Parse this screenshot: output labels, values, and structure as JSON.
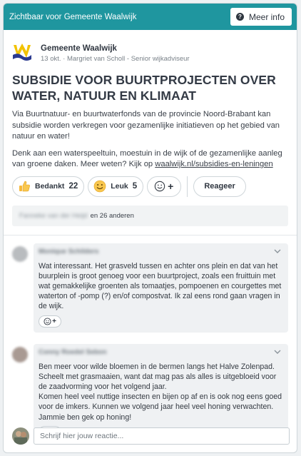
{
  "topbar": {
    "title": "Zichtbaar voor Gemeente Waalwijk",
    "info_label": "Meer info"
  },
  "post": {
    "author": "Gemeente Waalwijk",
    "meta": "13 okt. · Margriet van Scholl - Senior wijkadviseur",
    "title": "SUBSIDIE VOOR BUURTPROJECTEN OVER WATER, NATUUR EN KLIMAAT",
    "paragraph1": "Via Buurtnatuur- en buurtwaterfonds van de provincie Noord-Brabant kan subsidie worden verkregen voor gezamenlijke initiatieven op het gebied van natuur en water!",
    "paragraph2_prefix": "Denk aan een waterspeeltuin, moestuin in de wijk of de gezamenlijke aanleg van groene daken. Meer weten? Kijk op ",
    "link_text": "waalwijk.nl/subsidies-en-leningen"
  },
  "reactions": {
    "bedankt_label": "Bedankt",
    "bedankt_count": "22",
    "leuk_label": "Leuk",
    "leuk_count": "5",
    "add_label": "+",
    "reply_label": "Reageer"
  },
  "liked_by": {
    "blurred_name": "Fanneke van der Heijd",
    "others": "en 26 anderen"
  },
  "comments": [
    {
      "name": "Monique Schilders",
      "text": "Wat interessant. Het grasveld tussen en achter ons plein en dat van het buurplein is groot genoeg voor een buurtproject, zoals een fruittuin met wat gemakkelijke groenten als tomaatjes, pompoenen en courgettes met waterton of -pomp (?) en/of compostvat. Ik zal eens rond gaan vragen in de wijk.",
      "emoji_add": "+"
    },
    {
      "name": "Conny Roedel Sebon",
      "text_lines": [
        "Ben meer voor wilde bloemen in de bermen langs het Halve Zolenpad. Scheelt met grasmaaien, want dat mag pas als alles is uitgebloeid voor de zaadvorming voor het volgend jaar.",
        "Komen heel veel nuttige insecten en bijen op af en is ook nog eens goed voor de imkers. Kunnen we volgend jaar heel veel honing verwachten.",
        "Jammie ben gek op honing!"
      ],
      "emoji_add": "+"
    }
  ],
  "reply": {
    "placeholder": "Schrijf hier jouw reactie..."
  },
  "colors": {
    "topbar": "#1f969f",
    "logo_yellow": "#f2c200",
    "logo_blue": "#2b3a8f"
  },
  "icons": [
    "question-icon",
    "waalwijk-logo",
    "thumbs-up-icon",
    "smiley-icon",
    "emoji-add-icon",
    "chevron-down-icon"
  ]
}
